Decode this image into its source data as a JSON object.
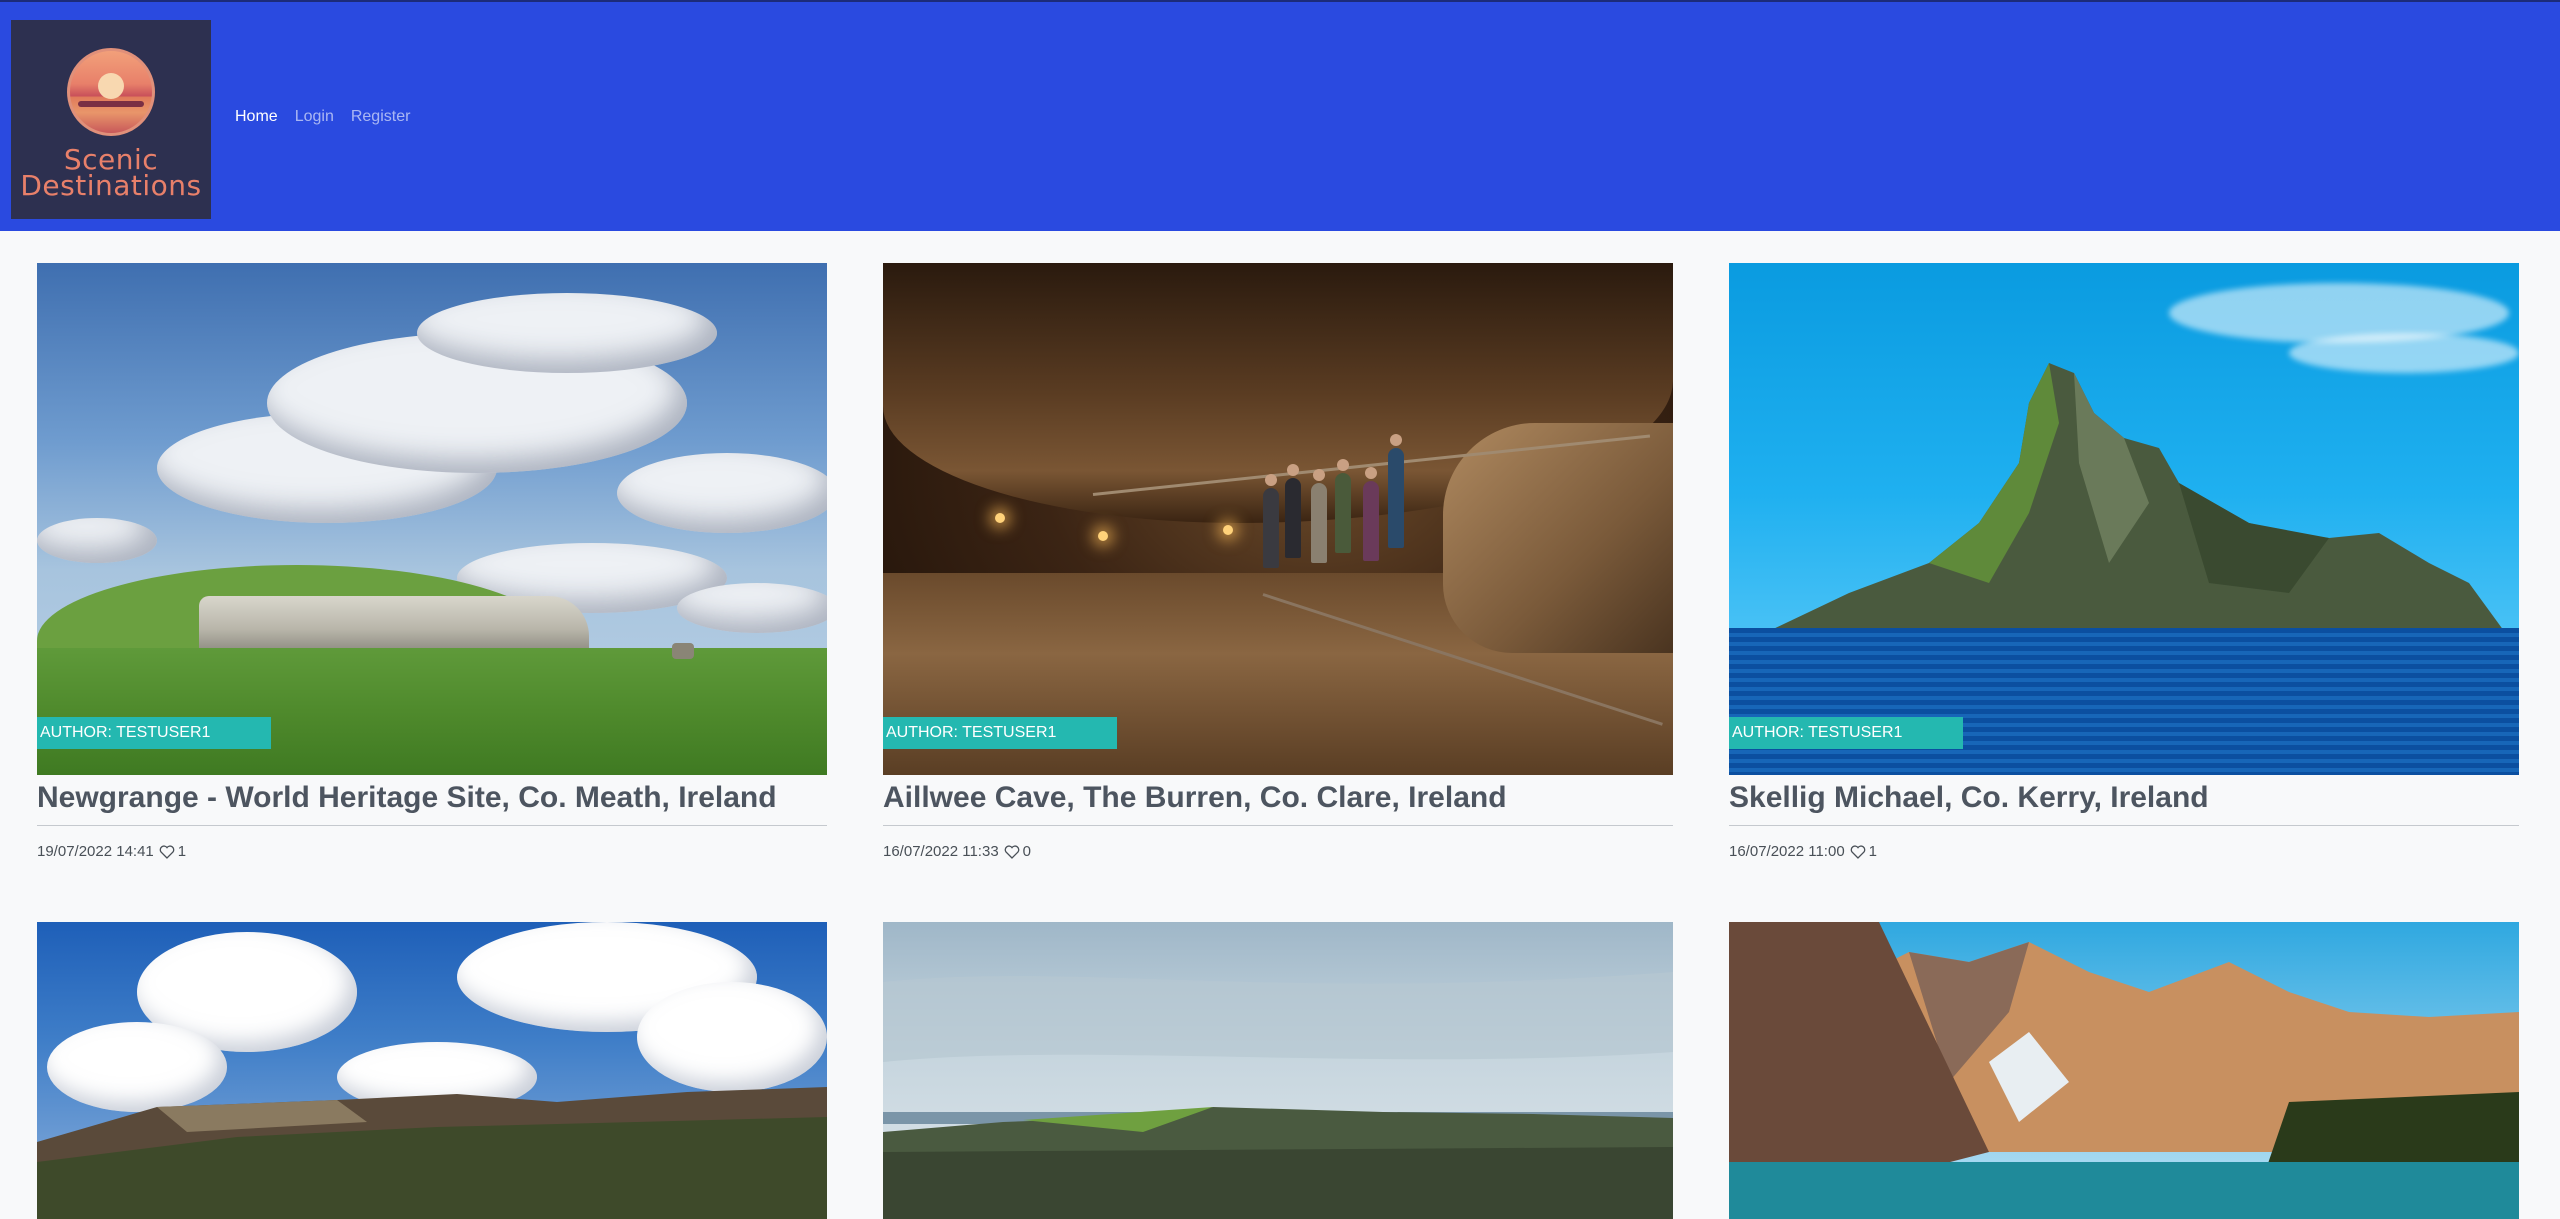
{
  "brand": {
    "line1": "Scenic",
    "line2": "Destinations",
    "colors": {
      "navbar": "#2a4ae0",
      "accent": "#24b8b0",
      "logo_text": "#e8806a"
    }
  },
  "nav": {
    "home": "Home",
    "login": "Login",
    "register": "Register",
    "active": "Home"
  },
  "posts": [
    {
      "author": "AUTHOR: TESTUSER1",
      "title": "Newgrange - World Heritage Site, Co. Meath, Ireland",
      "date": "19/07/2022 14:41",
      "likes": "1",
      "like_icon": "heart-outline-icon"
    },
    {
      "author": "AUTHOR: TESTUSER1",
      "title": "Aillwee Cave, The Burren, Co. Clare, Ireland",
      "date": "16/07/2022 11:33",
      "likes": "0",
      "like_icon": "heart-outline-icon"
    },
    {
      "author": "AUTHOR: TESTUSER1",
      "title": "Skellig Michael, Co. Kerry, Ireland",
      "date": "16/07/2022 11:00",
      "likes": "1",
      "like_icon": "heart-outline-icon"
    }
  ]
}
